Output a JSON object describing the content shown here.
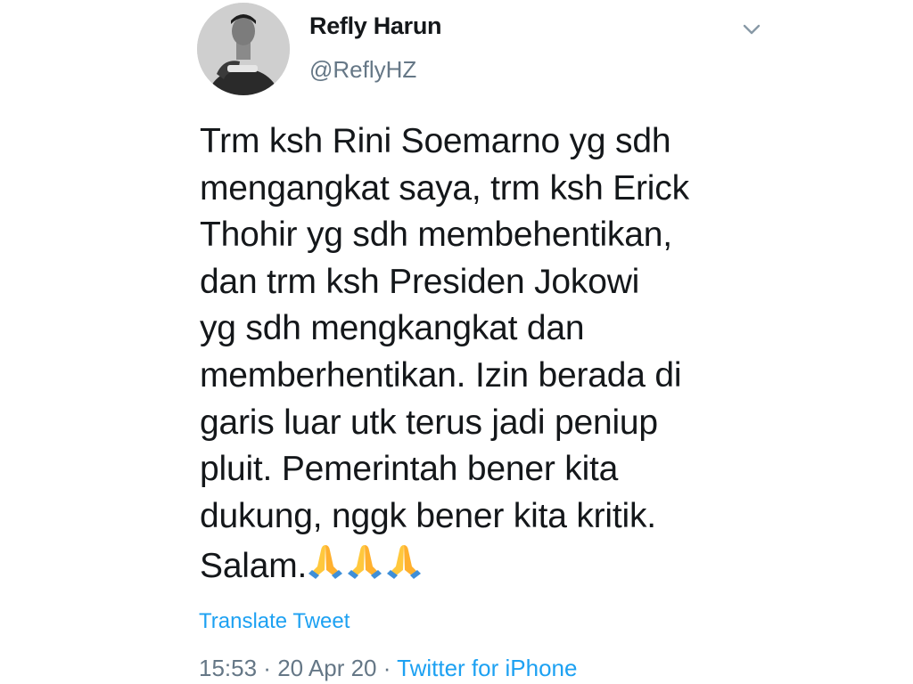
{
  "author": {
    "display_name": "Refly Harun",
    "handle": "@ReflyHZ"
  },
  "tweet": {
    "text": "Trm ksh Rini Soemarno yg sdh\nmengangkat saya, trm ksh Erick\nThohir yg sdh membehentikan,\ndan trm ksh Presiden Jokowi\nyg sdh mengkangkat dan\nmemberhentikan. Izin berada di\ngaris luar utk terus jadi peniup\npluit. Pemerintah bener kita\ndukung, nggk bener kita kritik.\nSalam.",
    "emoji": [
      "🙏",
      "🙏",
      "🙏"
    ],
    "translate_label": "Translate Tweet"
  },
  "meta": {
    "time": "15:53",
    "sep1": " · ",
    "date": "20 Apr 20",
    "sep2": " · ",
    "source": "Twitter for iPhone"
  },
  "colors": {
    "link": "#1da1f2",
    "muted": "#657786",
    "text": "#14171a"
  },
  "icons": {
    "menu": "chevron-down-icon",
    "emoji": "folded-hands-icon"
  }
}
